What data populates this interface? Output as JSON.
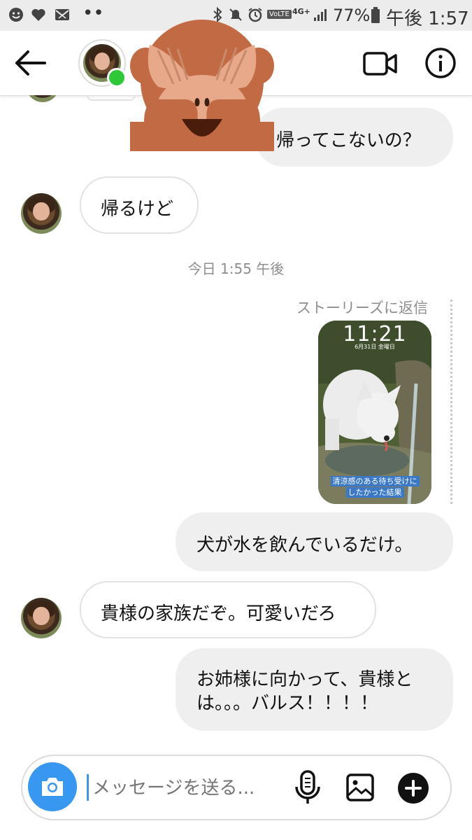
{
  "status_bar": {
    "network": "4G+",
    "volte": "VoLTE",
    "battery": "77%",
    "time": "午後 1:57",
    "dots": "••"
  },
  "header": {
    "back_icon": "arrow-left-icon",
    "video_icon": "video-camera-icon",
    "info_icon": "info-icon"
  },
  "messages": [
    {
      "side": "out",
      "text": "帰ってこないの？"
    },
    {
      "side": "in",
      "text": "帰るけど"
    },
    {
      "side": "out",
      "text": "犬が水を飲んでいるだけ。"
    },
    {
      "side": "in",
      "text": "貴様の家族だぞ。可愛いだろ"
    },
    {
      "side": "out",
      "lines": [
        "お姉様に向かって、貴様と",
        "は。。。バルス！！！！"
      ]
    }
  ],
  "timestamp": "今日 1:55 午後",
  "story_reply": {
    "label": "ストーリーズに返信",
    "story_time": "11:21",
    "story_date": "6月31日 金曜日",
    "caption_line1": "清涼感のある待ち受けに",
    "caption_line2": "したかった結果"
  },
  "composer": {
    "placeholder": "メッセージを送る..."
  },
  "colors": {
    "accent_blue": "#3897f0",
    "online_green": "#2dc937",
    "bubble_gray": "#efefef"
  }
}
